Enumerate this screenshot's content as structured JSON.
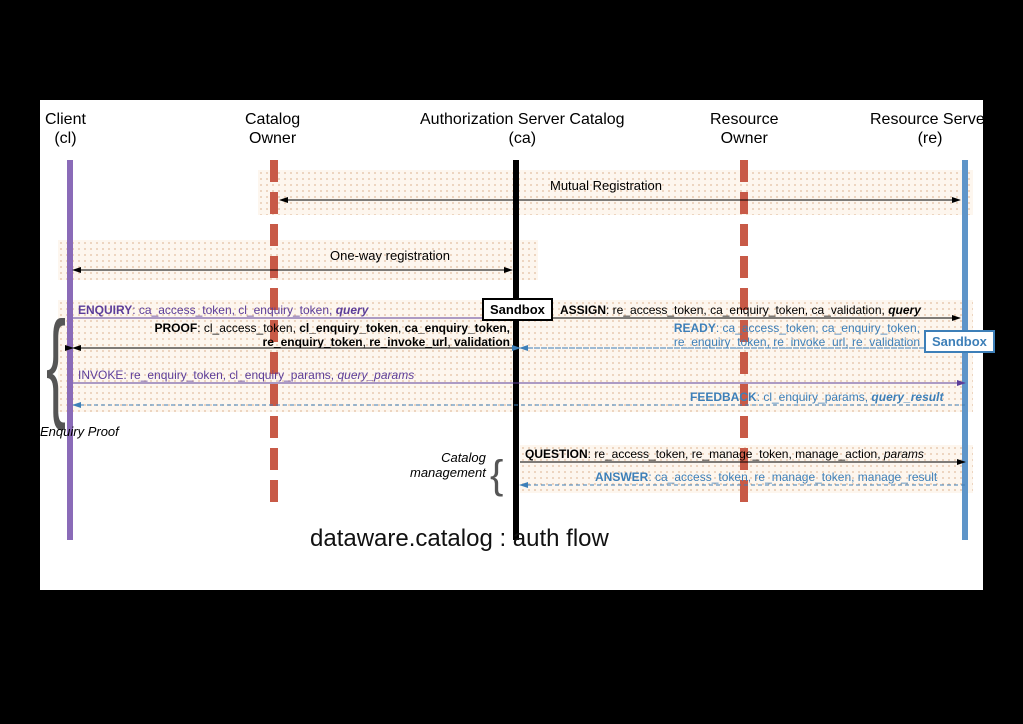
{
  "actors": {
    "client": "Client\n(cl)",
    "catalog_owner": "Catalog\nOwner",
    "auth_server": "Authorization Server Catalog\n(ca)",
    "resource_owner": "Resource\nOwner",
    "resource_server": "Resource Server\n(re)"
  },
  "bands": {
    "mutual_registration": "Mutual Registration",
    "one_way_registration": "One-way registration"
  },
  "sandbox": "Sandbox",
  "messages": {
    "enquiry": {
      "label": "ENQUIRY",
      "params": ": ca_access_token, cl_enquiry_token, ",
      "tail": "query"
    },
    "assign": {
      "label": "ASSIGN",
      "params": ": re_access_token, ca_enquiry_token, ca_validation, ",
      "tail": "query"
    },
    "proof": {
      "label": "PROOF",
      "params": ": cl_access_token, ",
      "bold": "cl_enquiry_token",
      "params2": ", ",
      "bold2": "ca_enquiry_token,\nre_enquiry_token",
      "params3": ", ",
      "bold3": "re_invoke_url",
      "params4": ", ",
      "bold4": "validation"
    },
    "ready": {
      "label": "READY",
      "params": ": ca_access_token, ca_enquiry_token,\nre_enquiry_token, re_invoke_url, re_validation"
    },
    "invoke": {
      "label": "INVOKE",
      "params": ": re_enquiry_token, cl_enquiry_params, ",
      "tail": "query_params"
    },
    "feedback": {
      "label": "FEEDBACK",
      "params": ": cl_enquiry_params, ",
      "tail": "query_result"
    },
    "question": {
      "label": "QUESTION",
      "params": ": re_access_token, re_manage_token, manage_action, ",
      "tail": "params"
    },
    "answer": {
      "label": "ANSWER",
      "params": ": ca_access_token, re_manage_token, manage_result"
    }
  },
  "labels": {
    "enquiry_proof": "Enquiry Proof",
    "catalog_mgmt": "Catalog\nmanagement"
  },
  "diagram_title": "dataware.catalog : auth flow"
}
